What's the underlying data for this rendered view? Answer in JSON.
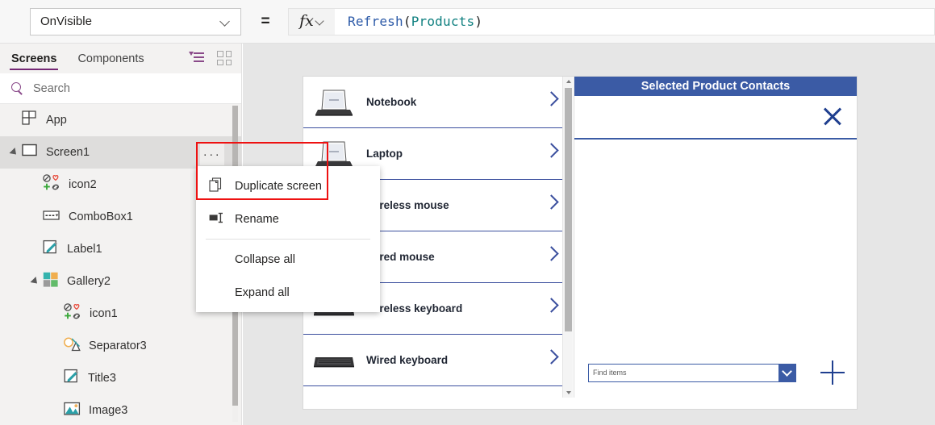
{
  "formula_bar": {
    "property": "OnVisible",
    "equals": "=",
    "fx_label": "fx",
    "formula": {
      "fn": "Refresh",
      "open": "( ",
      "table": "Products",
      "close": " )"
    }
  },
  "sidebar": {
    "tabs": [
      {
        "label": "Screens",
        "active": true
      },
      {
        "label": "Components",
        "active": false
      }
    ],
    "view_icons": [
      {
        "name": "tree-view-icon"
      },
      {
        "name": "thumbnail-view-icon"
      }
    ],
    "search": {
      "placeholder": "Search",
      "value": ""
    },
    "tree": [
      {
        "label": "App",
        "icon": "app-icon",
        "depth": 0,
        "twisty": false,
        "selected": false
      },
      {
        "label": "Screen1",
        "icon": "screen-icon",
        "depth": 0,
        "twisty": true,
        "selected": true
      },
      {
        "label": "icon2",
        "icon": "icons-icon",
        "depth": 1,
        "twisty": false,
        "selected": false
      },
      {
        "label": "ComboBox1",
        "icon": "combobox-icon",
        "depth": 1,
        "twisty": false,
        "selected": false
      },
      {
        "label": "Label1",
        "icon": "label-icon",
        "depth": 1,
        "twisty": false,
        "selected": false
      },
      {
        "label": "Gallery2",
        "icon": "gallery-icon",
        "depth": 1,
        "twisty": true,
        "selected": false
      },
      {
        "label": "icon1",
        "icon": "icons-icon",
        "depth": 2,
        "twisty": false,
        "selected": false
      },
      {
        "label": "Separator3",
        "icon": "separator-icon",
        "depth": 2,
        "twisty": false,
        "selected": false
      },
      {
        "label": "Title3",
        "icon": "label-icon",
        "depth": 2,
        "twisty": false,
        "selected": false
      },
      {
        "label": "Image3",
        "icon": "image-icon",
        "depth": 2,
        "twisty": false,
        "selected": false
      }
    ]
  },
  "context_menu": {
    "ellipsis": "···",
    "items": [
      {
        "label": "Duplicate screen",
        "icon": "duplicate-icon",
        "highlighted": true
      },
      {
        "label": "Rename",
        "icon": "rename-icon",
        "highlighted": false
      },
      {
        "label": "Collapse all",
        "icon": null,
        "highlighted": false
      },
      {
        "label": "Expand all",
        "icon": null,
        "highlighted": false
      }
    ]
  },
  "canvas": {
    "gallery": {
      "items": [
        {
          "name": "Notebook",
          "thumb": "laptop-photo"
        },
        {
          "name": "Laptop",
          "thumb": "laptop-photo"
        },
        {
          "name": "Wireless mouse",
          "thumb": "mouse-photo"
        },
        {
          "name": "Wired mouse",
          "thumb": "mouse-photo"
        },
        {
          "name": "Wireless keyboard",
          "thumb": "keyboard-photo"
        },
        {
          "name": "Wired keyboard",
          "thumb": "keyboard-photo"
        }
      ]
    },
    "detail_panel": {
      "title": "Selected Product Contacts",
      "combo_placeholder": "Find items",
      "close_icon": "close-icon",
      "add_icon": "plus-icon"
    }
  },
  "colors": {
    "accent_purple": "#742774",
    "panel_blue": "#3b5ba5",
    "formula_fn_blue": "#2c5aa8",
    "formula_table_teal": "#108080",
    "annotation_red": "#ee1111",
    "sidebar_bg": "#f3f2f1",
    "canvas_bg": "#e6e6e6"
  }
}
